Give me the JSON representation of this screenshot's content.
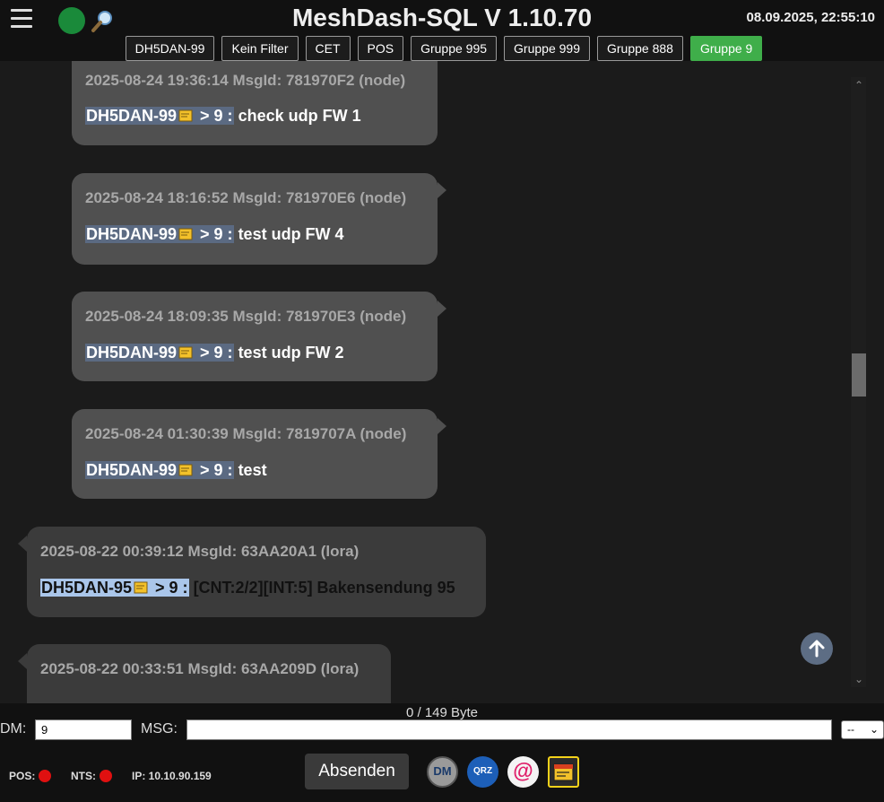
{
  "header": {
    "title": "MeshDash-SQL V 1.10.70",
    "datetime": "08.09.2025, 22:55:10",
    "filters": [
      {
        "label": "DH5DAN-99",
        "active": false
      },
      {
        "label": "Kein Filter",
        "active": false
      },
      {
        "label": "CET",
        "active": false
      },
      {
        "label": "POS",
        "active": false
      },
      {
        "label": "Gruppe 995",
        "active": false
      },
      {
        "label": "Gruppe 999",
        "active": false
      },
      {
        "label": "Gruppe 888",
        "active": false
      },
      {
        "label": "Gruppe 9",
        "active": true
      }
    ]
  },
  "messages": [
    {
      "meta": "2025-08-24 19:36:14 MsgId: 781970F2 (node)",
      "callsign": "DH5DAN-99",
      "target": " > 9 :",
      "text": " check udp FW 1",
      "direction": "out"
    },
    {
      "meta": "2025-08-24 18:16:52 MsgId: 781970E6 (node)",
      "callsign": "DH5DAN-99",
      "target": " > 9 :",
      "text": " test udp FW 4",
      "direction": "out"
    },
    {
      "meta": "2025-08-24 18:09:35 MsgId: 781970E3 (node)",
      "callsign": "DH5DAN-99",
      "target": " > 9 :",
      "text": " test udp FW 2",
      "direction": "out"
    },
    {
      "meta": "2025-08-24 01:30:39 MsgId: 7819707A (node)",
      "callsign": "DH5DAN-99",
      "target": " > 9 :",
      "text": " test",
      "direction": "out"
    },
    {
      "meta": "2025-08-22 00:39:12 MsgId: 63AA20A1 (lora)",
      "callsign": "DH5DAN-95",
      "target": " > 9 :",
      "text": " [CNT:2/2][INT:5] Bakensendung 95",
      "direction": "in"
    },
    {
      "meta": "2025-08-22 00:33:51 MsgId: 63AA209D (lora)",
      "callsign": "",
      "target": "",
      "text": "",
      "direction": "in"
    }
  ],
  "compose": {
    "counter": "0 / 149 Byte",
    "dm_label": "DM:",
    "dm_value": "9",
    "msg_label": "MSG:",
    "msg_value": "",
    "select_value": "--",
    "send_label": "Absenden"
  },
  "status": {
    "pos_label": "POS:",
    "nts_label": "NTS:",
    "ip_label": "IP: 10.10.90.159"
  },
  "icons": {
    "dm": "DM",
    "qrz": "QRZ",
    "at": "@"
  },
  "colors": {
    "active_filter": "#3fae4a",
    "status_online": "#1a8a3a",
    "status_off": "#e01010"
  }
}
